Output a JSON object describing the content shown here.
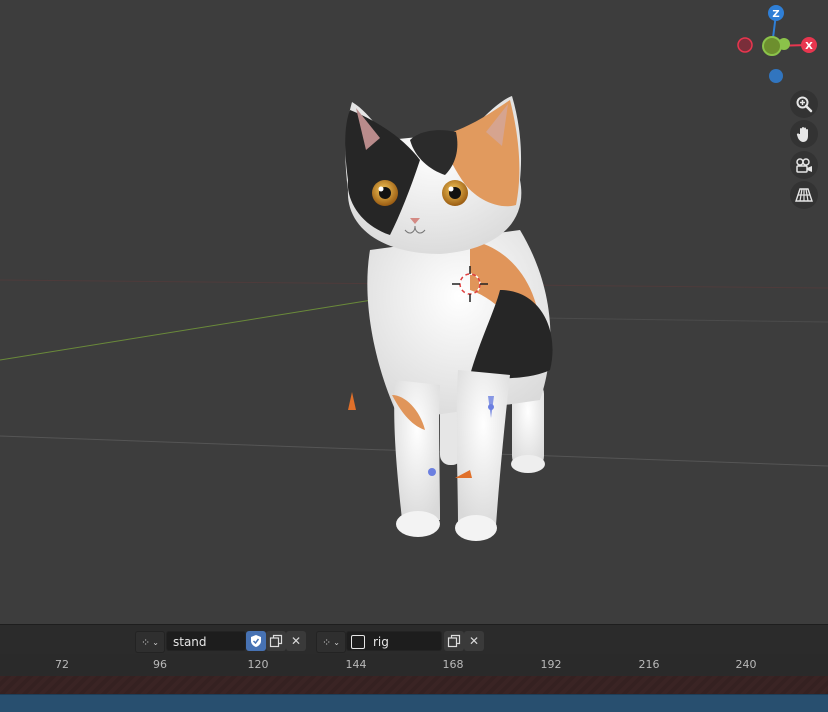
{
  "viewport": {
    "gizmo": {
      "z": "Z",
      "x": "X"
    },
    "nav_icons": [
      "zoom-icon",
      "hand-icon",
      "camera-icon",
      "perspective-grid-icon"
    ]
  },
  "action_bar": {
    "action_name": "stand",
    "slot_name": "rig"
  },
  "timeline": {
    "ticks": [
      "72",
      "96",
      "120",
      "144",
      "168",
      "192",
      "216",
      "240"
    ]
  },
  "colors": {
    "viewport_bg": "#3d3d3d",
    "axis_x": "#e8364f",
    "axis_y": "#8bc34a",
    "axis_z": "#2f7fd6",
    "accent": "#4772b3",
    "track_blue": "#284f6f"
  }
}
